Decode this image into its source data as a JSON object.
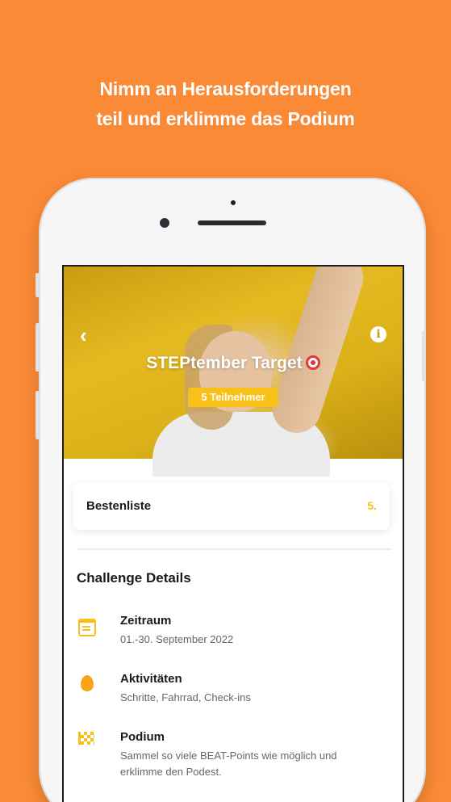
{
  "headline": {
    "line1": "Nimm an Herausforderungen",
    "line2": "teil und erklimme das Podium"
  },
  "challenge": {
    "title": "STEPtember Target",
    "participants_badge": "5 Teilnehmer"
  },
  "leaderboard": {
    "label": "Bestenliste",
    "rank": "5."
  },
  "details": {
    "section_title": "Challenge Details",
    "items": [
      {
        "icon": "calendar-icon",
        "title": "Zeitraum",
        "subtitle": "01.-30. September 2022"
      },
      {
        "icon": "fire-icon",
        "title": "Aktivitäten",
        "subtitle": "Schritte, Fahrrad, Check-ins"
      },
      {
        "icon": "checkered-flag-icon",
        "title": "Podium",
        "subtitle": "Sammel so viele BEAT-Points wie möglich und erklimme den Podest."
      }
    ]
  },
  "colors": {
    "background": "#FB8A36",
    "accent": "#F9C01A"
  }
}
